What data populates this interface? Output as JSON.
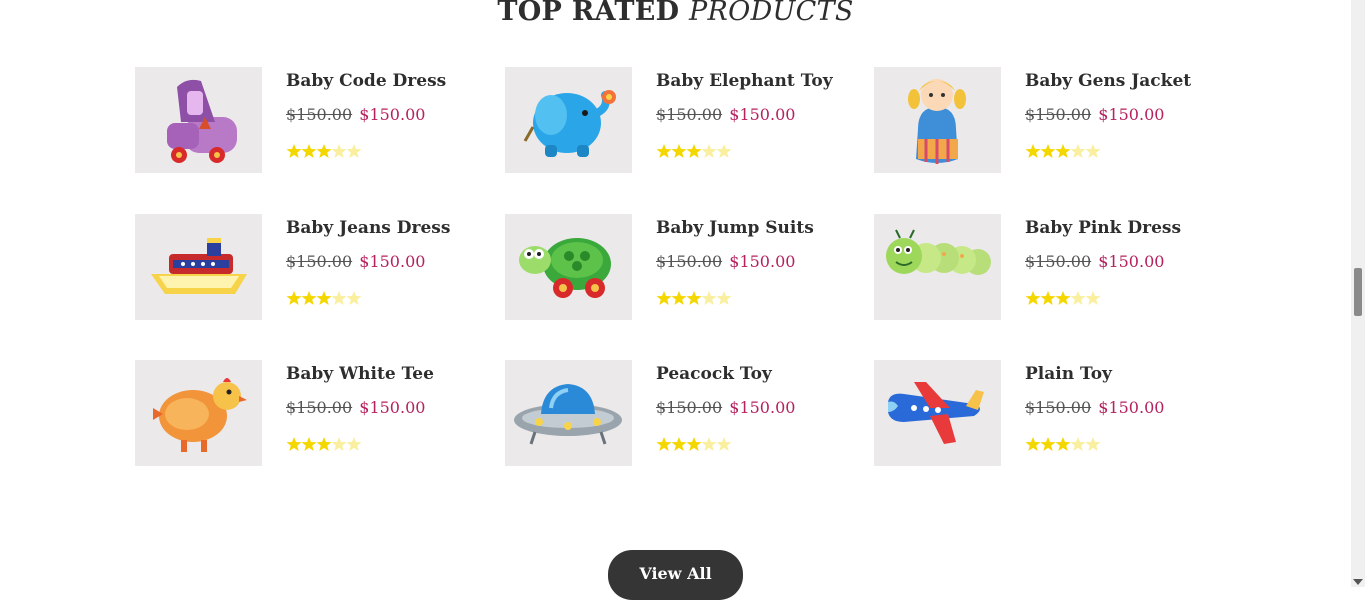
{
  "section": {
    "title_main": "TOP RATED",
    "title_accent": "PRODUCTS"
  },
  "products": [
    {
      "name": "Baby Code Dress",
      "old_price": "$150.00",
      "price": "$150.00",
      "rating": 3,
      "max_rating": 5,
      "icon": "toy-car-icon"
    },
    {
      "name": "Baby Elephant Toy",
      "old_price": "$150.00",
      "price": "$150.00",
      "rating": 3,
      "max_rating": 5,
      "icon": "elephant-toy-icon"
    },
    {
      "name": "Baby Gens Jacket",
      "old_price": "$150.00",
      "price": "$150.00",
      "rating": 3,
      "max_rating": 5,
      "icon": "doll-icon"
    },
    {
      "name": "Baby Jeans Dress",
      "old_price": "$150.00",
      "price": "$150.00",
      "rating": 3,
      "max_rating": 5,
      "icon": "toy-boat-icon"
    },
    {
      "name": "Baby Jump Suits",
      "old_price": "$150.00",
      "price": "$150.00",
      "rating": 3,
      "max_rating": 5,
      "icon": "turtle-toy-icon"
    },
    {
      "name": "Baby Pink Dress",
      "old_price": "$150.00",
      "price": "$150.00",
      "rating": 3,
      "max_rating": 5,
      "icon": "caterpillar-toy-icon"
    },
    {
      "name": "Baby White Tee",
      "old_price": "$150.00",
      "price": "$150.00",
      "rating": 3,
      "max_rating": 5,
      "icon": "hen-toy-icon"
    },
    {
      "name": "Peacock Toy",
      "old_price": "$150.00",
      "price": "$150.00",
      "rating": 3,
      "max_rating": 5,
      "icon": "ufo-toy-icon"
    },
    {
      "name": "Plain Toy",
      "old_price": "$150.00",
      "price": "$150.00",
      "rating": 3,
      "max_rating": 5,
      "icon": "airplane-toy-icon"
    }
  ],
  "actions": {
    "view_all_label": "View All"
  },
  "colors": {
    "price_accent": "#b5225e",
    "star_filled": "#f5d700",
    "star_empty": "#f9ef9e",
    "button_bg": "#353535",
    "thumb_bg": "#ebe9ea"
  }
}
